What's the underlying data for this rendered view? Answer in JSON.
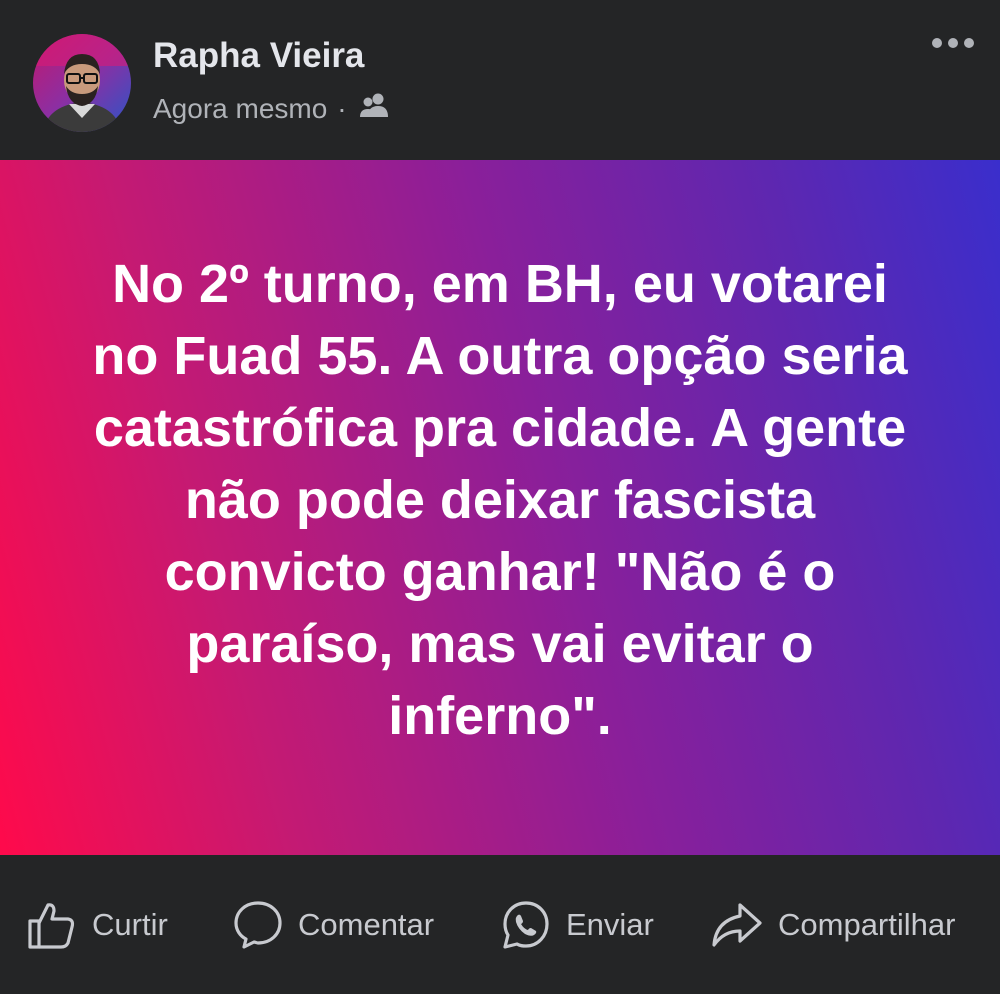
{
  "post": {
    "author": "Rapha Vieira",
    "timestamp": "Agora mesmo",
    "separator": "·",
    "audience_icon": "friends-icon",
    "text": "No 2º turno, em BH, eu votarei no Fuad 55. A outra opção seria catastrófica pra cidade. A gente não pode deixar fascista convicto ganhar! \"Não é o paraíso, mas vai evitar o inferno\".",
    "background_gradient": [
      "#ff0a4b",
      "#8a1f9a",
      "#3a2ecc"
    ]
  },
  "actions": {
    "like": {
      "label": "Curtir",
      "icon": "thumbs-up-icon"
    },
    "comment": {
      "label": "Comentar",
      "icon": "comment-icon"
    },
    "send": {
      "label": "Enviar",
      "icon": "whatsapp-icon"
    },
    "share": {
      "label": "Compartilhar",
      "icon": "share-icon"
    }
  },
  "colors": {
    "surface": "#242526",
    "primary_text": "#e4e6eb",
    "secondary_text": "#b0b3b8"
  }
}
